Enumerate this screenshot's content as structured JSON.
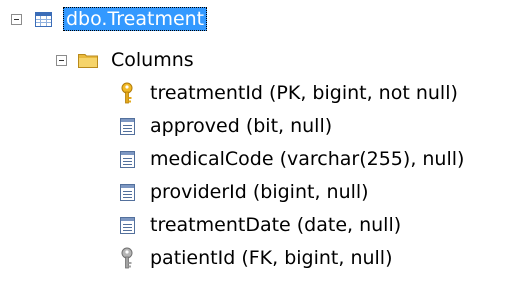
{
  "tree": {
    "table": {
      "label": "dbo.Treatment",
      "icon": "table-icon",
      "expanded": true,
      "selected": true
    },
    "columns_folder": {
      "label": "Columns",
      "icon": "folder-icon",
      "expanded": true
    },
    "columns": [
      {
        "label": "treatmentId (PK, bigint, not null)",
        "icon": "primary-key-icon"
      },
      {
        "label": "approved (bit, null)",
        "icon": "column-icon"
      },
      {
        "label": "medicalCode (varchar(255), null)",
        "icon": "column-icon"
      },
      {
        "label": "providerId (bigint, null)",
        "icon": "column-icon"
      },
      {
        "label": "treatmentDate (date, null)",
        "icon": "column-icon"
      },
      {
        "label": "patientId (FK, bigint, null)",
        "icon": "foreign-key-icon"
      }
    ]
  },
  "colors": {
    "selection": "#3399ff",
    "primary_key": "#e8a317",
    "foreign_key": "#9a9a9a",
    "column_icon": "#4a6fa5",
    "folder": "#f0c94a"
  }
}
